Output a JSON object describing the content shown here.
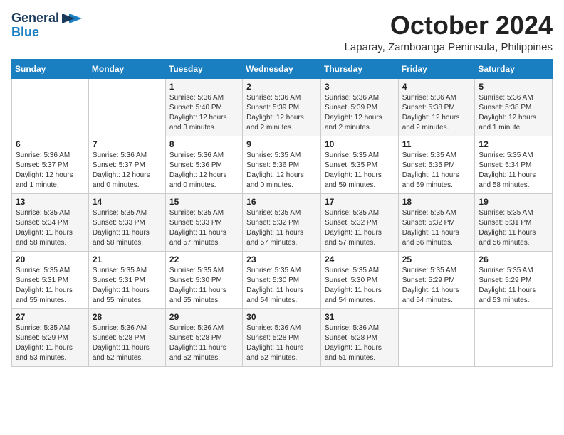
{
  "logo": {
    "line1": "General",
    "line2": "Blue"
  },
  "title": "October 2024",
  "location": "Laparay, Zamboanga Peninsula, Philippines",
  "weekdays": [
    "Sunday",
    "Monday",
    "Tuesday",
    "Wednesday",
    "Thursday",
    "Friday",
    "Saturday"
  ],
  "weeks": [
    [
      {
        "day": "",
        "info": ""
      },
      {
        "day": "",
        "info": ""
      },
      {
        "day": "1",
        "info": "Sunrise: 5:36 AM\nSunset: 5:40 PM\nDaylight: 12 hours and 3 minutes."
      },
      {
        "day": "2",
        "info": "Sunrise: 5:36 AM\nSunset: 5:39 PM\nDaylight: 12 hours and 2 minutes."
      },
      {
        "day": "3",
        "info": "Sunrise: 5:36 AM\nSunset: 5:39 PM\nDaylight: 12 hours and 2 minutes."
      },
      {
        "day": "4",
        "info": "Sunrise: 5:36 AM\nSunset: 5:38 PM\nDaylight: 12 hours and 2 minutes."
      },
      {
        "day": "5",
        "info": "Sunrise: 5:36 AM\nSunset: 5:38 PM\nDaylight: 12 hours and 1 minute."
      }
    ],
    [
      {
        "day": "6",
        "info": "Sunrise: 5:36 AM\nSunset: 5:37 PM\nDaylight: 12 hours and 1 minute."
      },
      {
        "day": "7",
        "info": "Sunrise: 5:36 AM\nSunset: 5:37 PM\nDaylight: 12 hours and 0 minutes."
      },
      {
        "day": "8",
        "info": "Sunrise: 5:36 AM\nSunset: 5:36 PM\nDaylight: 12 hours and 0 minutes."
      },
      {
        "day": "9",
        "info": "Sunrise: 5:35 AM\nSunset: 5:36 PM\nDaylight: 12 hours and 0 minutes."
      },
      {
        "day": "10",
        "info": "Sunrise: 5:35 AM\nSunset: 5:35 PM\nDaylight: 11 hours and 59 minutes."
      },
      {
        "day": "11",
        "info": "Sunrise: 5:35 AM\nSunset: 5:35 PM\nDaylight: 11 hours and 59 minutes."
      },
      {
        "day": "12",
        "info": "Sunrise: 5:35 AM\nSunset: 5:34 PM\nDaylight: 11 hours and 58 minutes."
      }
    ],
    [
      {
        "day": "13",
        "info": "Sunrise: 5:35 AM\nSunset: 5:34 PM\nDaylight: 11 hours and 58 minutes."
      },
      {
        "day": "14",
        "info": "Sunrise: 5:35 AM\nSunset: 5:33 PM\nDaylight: 11 hours and 58 minutes."
      },
      {
        "day": "15",
        "info": "Sunrise: 5:35 AM\nSunset: 5:33 PM\nDaylight: 11 hours and 57 minutes."
      },
      {
        "day": "16",
        "info": "Sunrise: 5:35 AM\nSunset: 5:32 PM\nDaylight: 11 hours and 57 minutes."
      },
      {
        "day": "17",
        "info": "Sunrise: 5:35 AM\nSunset: 5:32 PM\nDaylight: 11 hours and 57 minutes."
      },
      {
        "day": "18",
        "info": "Sunrise: 5:35 AM\nSunset: 5:32 PM\nDaylight: 11 hours and 56 minutes."
      },
      {
        "day": "19",
        "info": "Sunrise: 5:35 AM\nSunset: 5:31 PM\nDaylight: 11 hours and 56 minutes."
      }
    ],
    [
      {
        "day": "20",
        "info": "Sunrise: 5:35 AM\nSunset: 5:31 PM\nDaylight: 11 hours and 55 minutes."
      },
      {
        "day": "21",
        "info": "Sunrise: 5:35 AM\nSunset: 5:31 PM\nDaylight: 11 hours and 55 minutes."
      },
      {
        "day": "22",
        "info": "Sunrise: 5:35 AM\nSunset: 5:30 PM\nDaylight: 11 hours and 55 minutes."
      },
      {
        "day": "23",
        "info": "Sunrise: 5:35 AM\nSunset: 5:30 PM\nDaylight: 11 hours and 54 minutes."
      },
      {
        "day": "24",
        "info": "Sunrise: 5:35 AM\nSunset: 5:30 PM\nDaylight: 11 hours and 54 minutes."
      },
      {
        "day": "25",
        "info": "Sunrise: 5:35 AM\nSunset: 5:29 PM\nDaylight: 11 hours and 54 minutes."
      },
      {
        "day": "26",
        "info": "Sunrise: 5:35 AM\nSunset: 5:29 PM\nDaylight: 11 hours and 53 minutes."
      }
    ],
    [
      {
        "day": "27",
        "info": "Sunrise: 5:35 AM\nSunset: 5:29 PM\nDaylight: 11 hours and 53 minutes."
      },
      {
        "day": "28",
        "info": "Sunrise: 5:36 AM\nSunset: 5:28 PM\nDaylight: 11 hours and 52 minutes."
      },
      {
        "day": "29",
        "info": "Sunrise: 5:36 AM\nSunset: 5:28 PM\nDaylight: 11 hours and 52 minutes."
      },
      {
        "day": "30",
        "info": "Sunrise: 5:36 AM\nSunset: 5:28 PM\nDaylight: 11 hours and 52 minutes."
      },
      {
        "day": "31",
        "info": "Sunrise: 5:36 AM\nSunset: 5:28 PM\nDaylight: 11 hours and 51 minutes."
      },
      {
        "day": "",
        "info": ""
      },
      {
        "day": "",
        "info": ""
      }
    ]
  ]
}
